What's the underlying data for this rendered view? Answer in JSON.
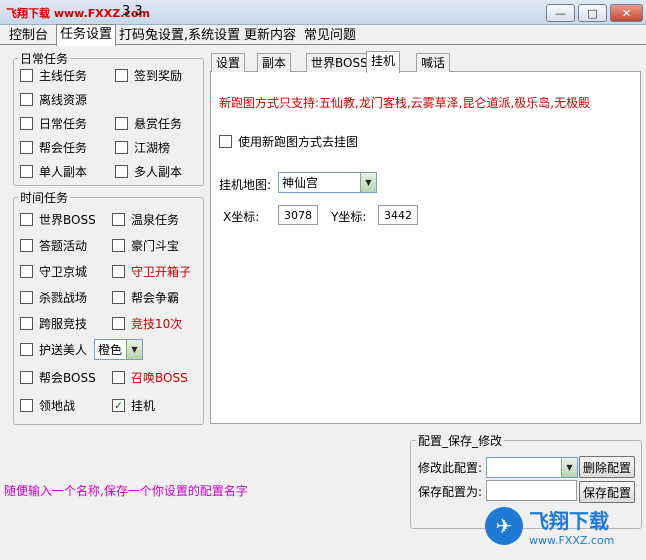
{
  "window": {
    "watermark": "飞翔下载 www.FXXZ.com",
    "version": "3.3",
    "minimize": "—",
    "maximize": "□",
    "close": "✕"
  },
  "main_tabs": [
    "控制台",
    "任务设置",
    "打码兔设置,系统设置",
    "更新内容",
    "常见问题"
  ],
  "daily": {
    "title": "日常任务",
    "items": [
      {
        "label": "主线任务",
        "checked": false
      },
      {
        "label": "签到奖励",
        "checked": false
      },
      {
        "label": "离线资源",
        "checked": false
      },
      {
        "label": "日常任务",
        "checked": false
      },
      {
        "label": "悬赏任务",
        "checked": false
      },
      {
        "label": "帮会任务",
        "checked": false
      },
      {
        "label": "江湖榜",
        "checked": false
      },
      {
        "label": "单人副本",
        "checked": false
      },
      {
        "label": "多人副本",
        "checked": false
      }
    ]
  },
  "timed": {
    "title": "时间任务",
    "items": [
      {
        "label": "世界BOSS",
        "checked": false
      },
      {
        "label": "温泉任务",
        "checked": false
      },
      {
        "label": "答题活动",
        "checked": false
      },
      {
        "label": "豪门斗宝",
        "checked": false
      },
      {
        "label": "守卫京城",
        "checked": false
      },
      {
        "label": "守卫开箱子",
        "checked": false
      },
      {
        "label": "杀戮战场",
        "checked": false
      },
      {
        "label": "帮会争霸",
        "checked": false
      },
      {
        "label": "跨服竞技",
        "checked": false
      },
      {
        "label": "竞技10次",
        "checked": false
      },
      {
        "label": "护送美人",
        "checked": false
      },
      {
        "label": "帮会BOSS",
        "checked": false
      },
      {
        "label": "召唤BOSS",
        "checked": false
      },
      {
        "label": "领地战",
        "checked": false
      },
      {
        "label": "挂机",
        "checked": true
      }
    ],
    "escort_color": "橙色",
    "check_mark": "✓"
  },
  "inner_tabs": [
    "设置",
    "副本",
    "世界BOSS",
    "挂机",
    "喊话"
  ],
  "afk": {
    "notice": "新跑图方式只支持:五仙教,龙门客栈,云雾草泽,昆仑道派,极乐岛,无极殿",
    "new_route_label": "使用新跑图方式去挂图",
    "map_label": "挂机地图:",
    "map_value": "神仙宫",
    "x_label": "X坐标:",
    "x_value": "3078",
    "y_label": "Y坐标:",
    "y_value": "3442"
  },
  "hint": "随便输入一个名称,保存一个你设置的配置名字",
  "config": {
    "title": "配置_保存_修改",
    "modify_label": "修改此配置:",
    "modify_value": "",
    "delete_button": "删除配置",
    "save_label": "保存配置为:",
    "save_value": "",
    "save_button": "保存配置"
  },
  "brand": {
    "logo_text": "飞翔下载",
    "url": "www.FXXZ.com"
  },
  "colors": {
    "red_text": "#cc0000",
    "hint": "#cc00cc",
    "brand_blue": "#1e7ad4"
  }
}
